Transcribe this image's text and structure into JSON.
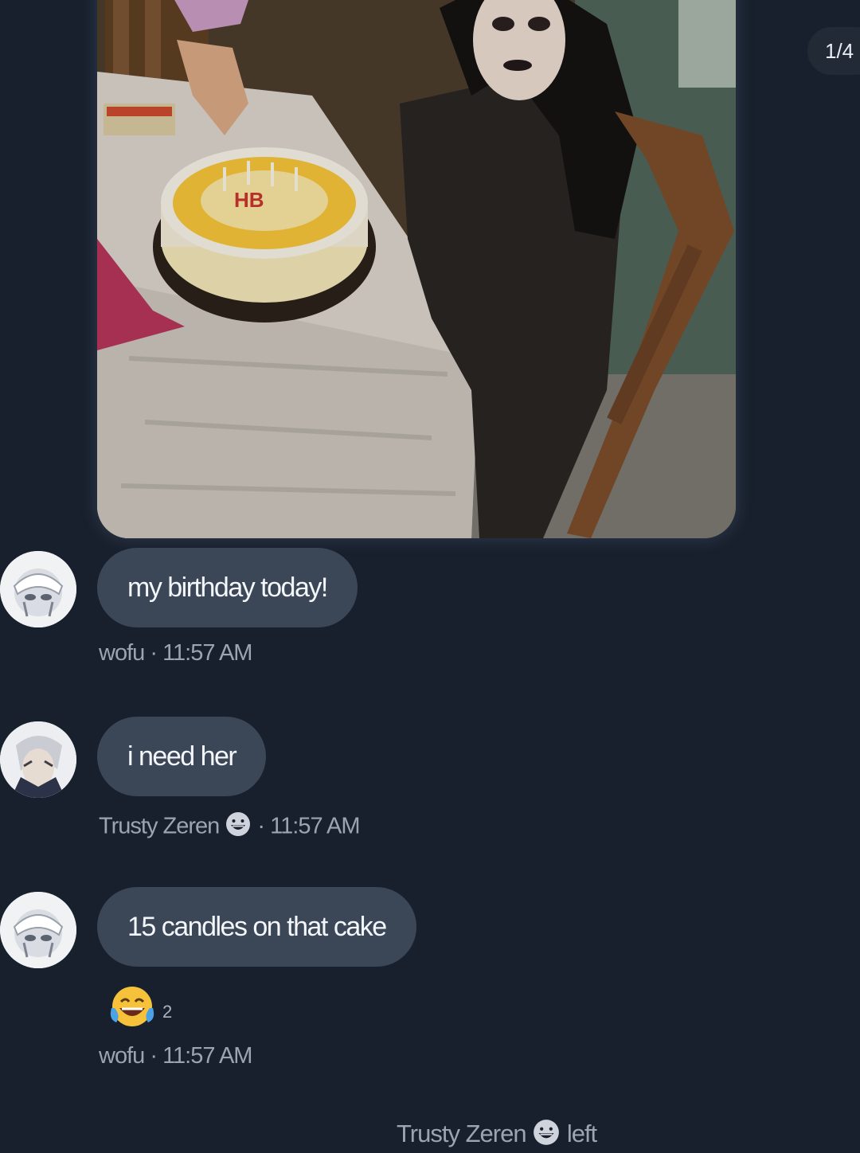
{
  "pagination": {
    "label": "1/4"
  },
  "messages": [
    {
      "text": "my birthday today!",
      "author": "wofu",
      "separator": "·",
      "time": "11:57 AM",
      "avatar_icon": "user-avatar-wofu"
    },
    {
      "text": "i need her",
      "author": "Trusty Zeren",
      "author_emoji": "grinning-face-icon",
      "separator": "·",
      "time": "11:57 AM",
      "avatar_icon": "user-avatar-trusty-zeren"
    },
    {
      "text": "15 candles on that cake",
      "author": "wofu",
      "separator": "·",
      "time": "11:57 AM",
      "avatar_icon": "user-avatar-wofu",
      "reaction": {
        "emoji": "tears-of-joy-icon",
        "count": "2"
      }
    }
  ],
  "system_message": {
    "user": "Trusty Zeren",
    "user_emoji": "grinning-face-icon",
    "action": "left"
  },
  "colors": {
    "background": "#18202d",
    "bubble": "#3b4657",
    "meta_text": "#9aa4b3"
  }
}
